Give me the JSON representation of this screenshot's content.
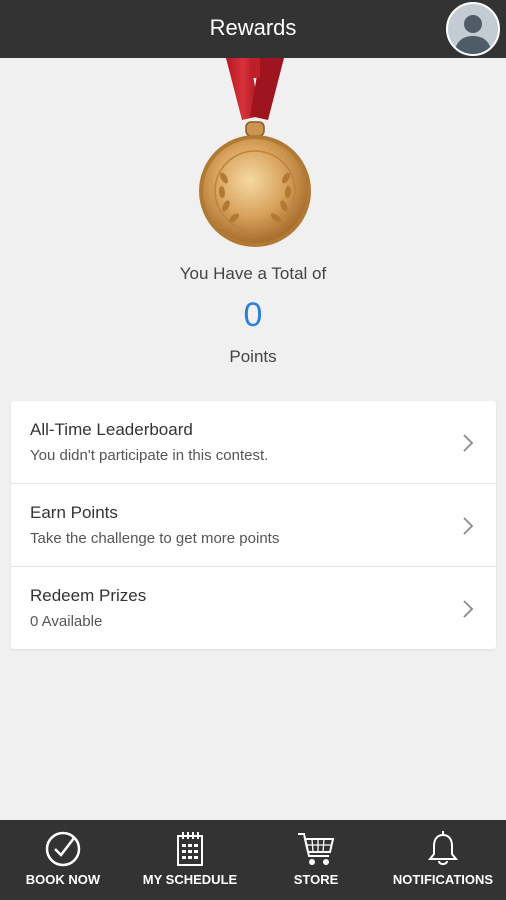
{
  "header": {
    "title": "Rewards"
  },
  "summary": {
    "total_label": "You Have a Total of",
    "points_value": "0",
    "points_label": "Points"
  },
  "menu": [
    {
      "title": "All-Time Leaderboard",
      "subtitle": "You didn't participate in this contest."
    },
    {
      "title": "Earn Points",
      "subtitle": "Take the challenge to get more points"
    },
    {
      "title": "Redeem Prizes",
      "subtitle": "0 Available"
    }
  ],
  "bottom_nav": [
    {
      "label": "BOOK NOW",
      "icon": "check-circle-icon"
    },
    {
      "label": "MY SCHEDULE",
      "icon": "calendar-icon"
    },
    {
      "label": "STORE",
      "icon": "cart-icon"
    },
    {
      "label": "NOTIFICATIONS",
      "icon": "bell-icon"
    }
  ],
  "colors": {
    "bar": "#333333",
    "points_accent": "#2f7fd8",
    "ribbon": "#c8202c",
    "medal": "#d3a15c"
  }
}
